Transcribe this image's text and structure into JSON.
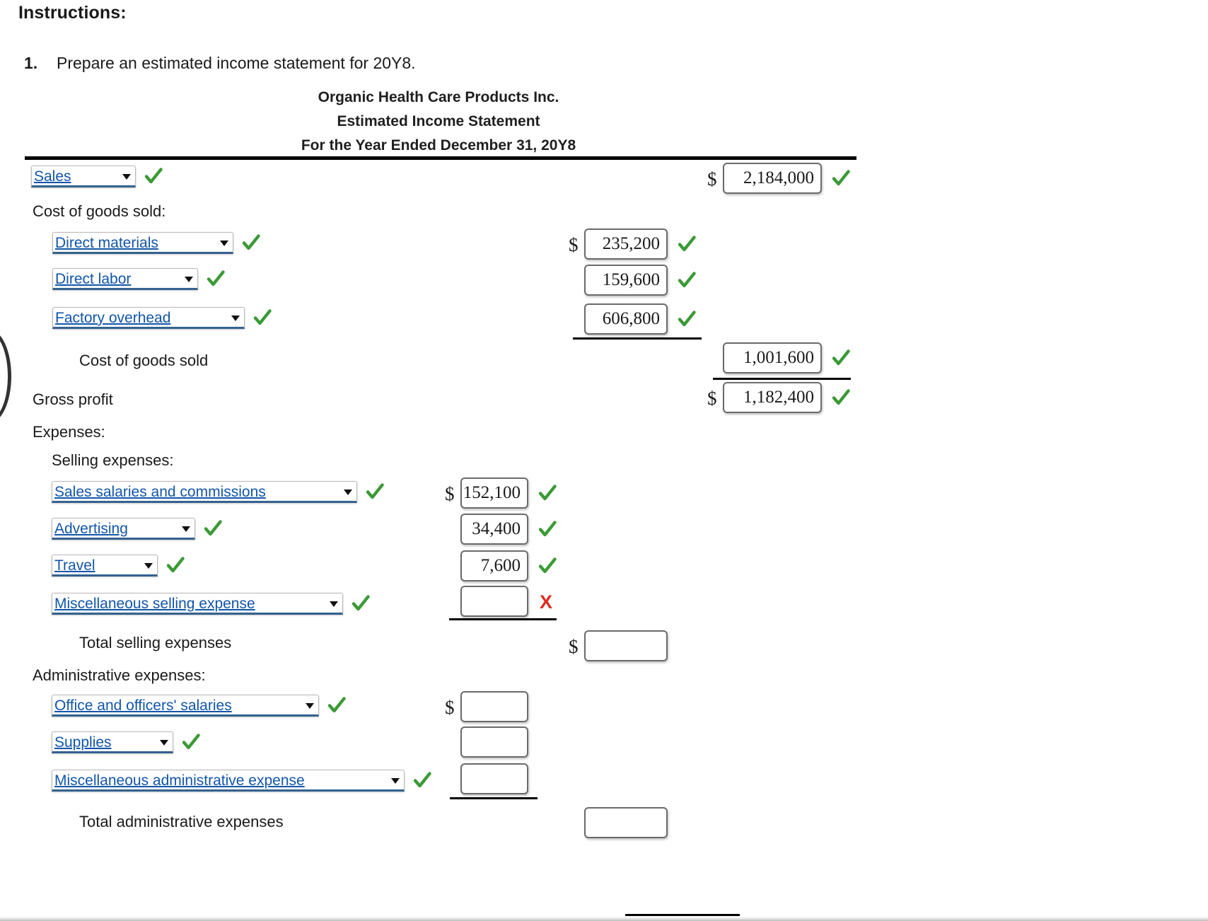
{
  "instructions": {
    "heading": "Instructions:",
    "item_number": "1.",
    "item_text": "Prepare an estimated income statement for 20Y8."
  },
  "statement": {
    "company": "Organic Health Care Products Inc.",
    "title": "Estimated Income Statement",
    "period": "For the Year Ended December 31, 20Y8"
  },
  "symbols": {
    "dollar": "$",
    "incorrect_mark": "X"
  },
  "colors": {
    "select_text": "#1155aa",
    "select_underline": "#33628f",
    "correct_mark": "#3a9a35",
    "incorrect_mark": "#e02b20",
    "rule": "#000000"
  },
  "rows": [
    {
      "id": "sales",
      "kind": "select",
      "label": "Sales",
      "label_status": "correct",
      "value": "2,184,000",
      "value_status": "correct",
      "value_column": "col3",
      "dollar": true
    },
    {
      "id": "cost-of-goods-sold-header",
      "kind": "text",
      "label": "Cost of goods sold:"
    },
    {
      "id": "direct-materials",
      "kind": "select",
      "label": "Direct materials",
      "label_status": "correct",
      "value": "235,200",
      "value_status": "correct",
      "value_column": "col2",
      "dollar": true
    },
    {
      "id": "direct-labor",
      "kind": "select",
      "label": "Direct labor",
      "label_status": "correct",
      "value": "159,600",
      "value_status": "correct",
      "value_column": "col2",
      "dollar": false
    },
    {
      "id": "factory-overhead",
      "kind": "select",
      "label": "Factory overhead",
      "label_status": "correct",
      "value": "606,800",
      "value_status": "correct",
      "value_column": "col2",
      "dollar": false
    },
    {
      "id": "cost-of-goods-sold-total",
      "kind": "text",
      "label": "Cost of goods sold",
      "value": "1,001,600",
      "value_status": "correct",
      "value_column": "col3",
      "dollar": false
    },
    {
      "id": "gross-profit",
      "kind": "text",
      "label": "Gross profit",
      "value": "1,182,400",
      "value_status": "correct",
      "value_column": "col3",
      "dollar": true
    },
    {
      "id": "expenses-header",
      "kind": "text",
      "label": "Expenses:"
    },
    {
      "id": "selling-expenses-header",
      "kind": "text",
      "label": "Selling expenses:"
    },
    {
      "id": "sales-salaries-and-commissions",
      "kind": "select",
      "label": "Sales salaries and commissions",
      "label_status": "correct",
      "value": "152,100",
      "value_status": "correct",
      "value_column": "col1",
      "dollar": true
    },
    {
      "id": "advertising",
      "kind": "select",
      "label": "Advertising",
      "label_status": "correct",
      "value": "34,400",
      "value_status": "correct",
      "value_column": "col1",
      "dollar": false
    },
    {
      "id": "travel",
      "kind": "select",
      "label": "Travel",
      "label_status": "correct",
      "value": "7,600",
      "value_status": "correct",
      "value_column": "col1",
      "dollar": false
    },
    {
      "id": "miscellaneous-selling-expense",
      "kind": "select",
      "label": "Miscellaneous selling expense",
      "label_status": "correct",
      "value": "",
      "value_status": "incorrect",
      "value_column": "col1",
      "dollar": false
    },
    {
      "id": "total-selling-expenses",
      "kind": "text",
      "label": "Total selling expenses",
      "value": "",
      "value_status": "none",
      "value_column": "col2",
      "dollar": true
    },
    {
      "id": "administrative-expenses-header",
      "kind": "text",
      "label": "Administrative expenses:"
    },
    {
      "id": "office-and-officers-salaries",
      "kind": "select",
      "label": "Office and officers' salaries",
      "label_status": "correct",
      "value": "",
      "value_status": "none",
      "value_column": "col1",
      "dollar": true
    },
    {
      "id": "supplies",
      "kind": "select",
      "label": "Supplies",
      "label_status": "correct",
      "value": "",
      "value_status": "none",
      "value_column": "col1",
      "dollar": false
    },
    {
      "id": "miscellaneous-administrative-expense",
      "kind": "select",
      "label": "Miscellaneous administrative expense",
      "label_status": "correct",
      "value": "",
      "value_status": "none",
      "value_column": "col1",
      "dollar": false
    },
    {
      "id": "total-administrative-expenses",
      "kind": "text",
      "label": "Total administrative expenses",
      "value": "",
      "value_status": "none",
      "value_column": "col2",
      "dollar": false
    }
  ]
}
